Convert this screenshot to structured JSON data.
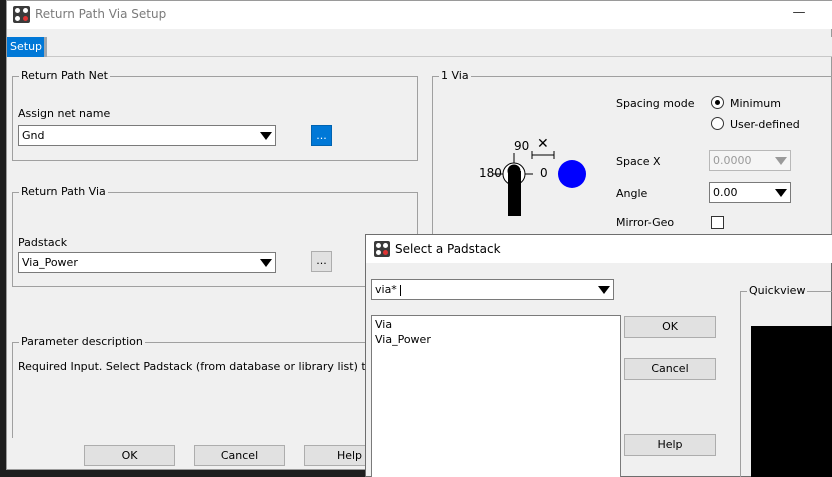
{
  "window": {
    "title": "Return Path Via Setup",
    "minimize_glyph": "—",
    "tabs": [
      "Setup"
    ]
  },
  "return_path_net": {
    "group_title": "Return Path Net",
    "assign_label": "Assign net name",
    "net_value": "Gnd",
    "browse_label": "..."
  },
  "return_path_via": {
    "group_title": "Return Path Via",
    "padstack_label": "Padstack",
    "padstack_value": "Via_Power",
    "browse_label": "..."
  },
  "parameter_description": {
    "group_title": "Parameter description",
    "text": "Required Input. Select Padstack (from database or library list) to use"
  },
  "via_panel": {
    "group_title": "1 Via",
    "angle_diagram": {
      "label_90": "90",
      "label_180": "180",
      "label_0": "0",
      "x_mark": "✕"
    },
    "spacing_mode_label": "Spacing mode",
    "spacing_options": [
      "Minimum",
      "User-defined"
    ],
    "spacing_selected": "Minimum",
    "space_x_label": "Space X",
    "space_x_value": "0.0000",
    "angle_label": "Angle",
    "angle_value": "0.00",
    "mirror_label": "Mirror-Geo",
    "mirror_checked": false
  },
  "bottom_buttons": {
    "ok": "OK",
    "cancel": "Cancel",
    "help": "Help"
  },
  "padstack_dialog": {
    "title": "Select a Padstack",
    "filter_value": "via*",
    "items": [
      "Via",
      "Via_Power"
    ],
    "ok_label": "OK",
    "cancel_label": "Cancel",
    "help_label": "Help",
    "quickview_title": "Quickview"
  },
  "colors": {
    "accent": "#0078d7",
    "via_dot": "#0000ff",
    "quickview_bg": "#000000"
  }
}
